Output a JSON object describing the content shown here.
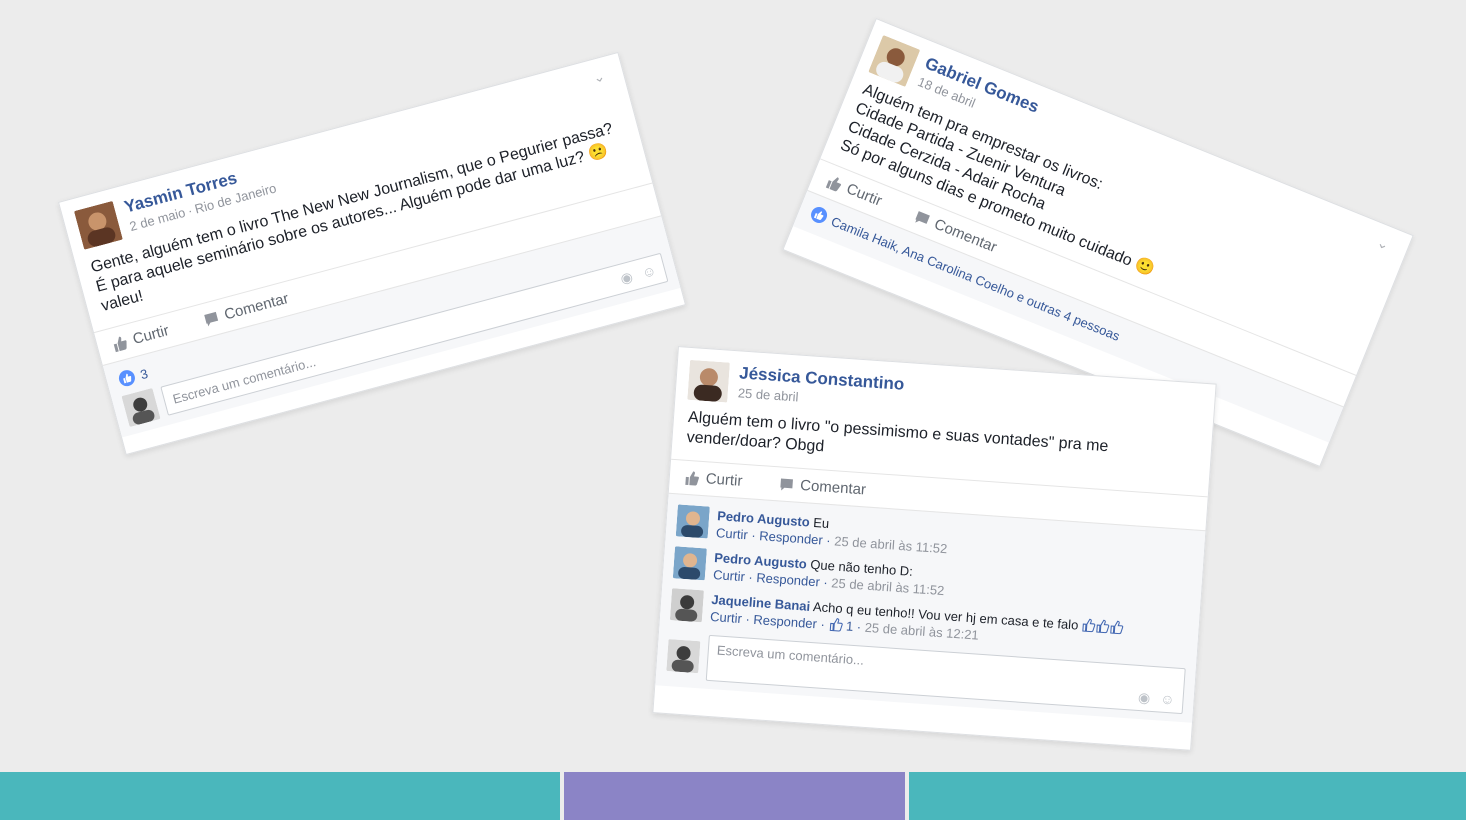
{
  "posts": {
    "yasmin": {
      "author": "Yasmin Torres",
      "date": "2 de maio",
      "location": "Rio de Janeiro",
      "text": "Gente, alguém tem o livro The New New Journalism, que o Pegurier passa? É para aquele seminário sobre os autores... Alguém pode dar uma luz? 😕 valeu!",
      "like_label": "Curtir",
      "comment_label": "Comentar",
      "likes_count": "3",
      "comment_placeholder": "Escreva um comentário..."
    },
    "gabriel": {
      "author": "Gabriel Gomes",
      "date": "18 de abril",
      "text": "Alguém tem pra emprestar os livros:\nCidade Partida - Zuenir Ventura\nCidade Cerzida - Adair Rocha\nSó por alguns dias e prometo muito cuidado 🙂",
      "like_label": "Curtir",
      "comment_label": "Comentar",
      "likes_text": "Camila Haik, Ana Carolina Coelho e outras 4 pessoas"
    },
    "jessica": {
      "author": "Jéssica Constantino",
      "date": "25 de abril",
      "text": "Alguém tem o livro \"o pessimismo e suas vontades\" pra me vender/doar? Obgd",
      "like_label": "Curtir",
      "comment_label": "Comentar",
      "comments": [
        {
          "name": "Pedro Augusto",
          "text": "Eu",
          "like": "Curtir",
          "reply": "Responder",
          "time": "25 de abril às 11:52"
        },
        {
          "name": "Pedro Augusto",
          "text": "Que não tenho D:",
          "like": "Curtir",
          "reply": "Responder",
          "time": "25 de abril às 11:52"
        },
        {
          "name": "Jaqueline Banai",
          "text": "Acho q eu tenho!! Vou ver hj em casa e te falo",
          "like": "Curtir",
          "reply": "Responder",
          "likes": "1",
          "time": "25 de abril às 12:21"
        }
      ],
      "comment_placeholder": "Escreva um comentário..."
    }
  },
  "footer": {
    "colors": [
      "#4ab7bc",
      "#8b84c6",
      "#4ab7bc"
    ]
  }
}
